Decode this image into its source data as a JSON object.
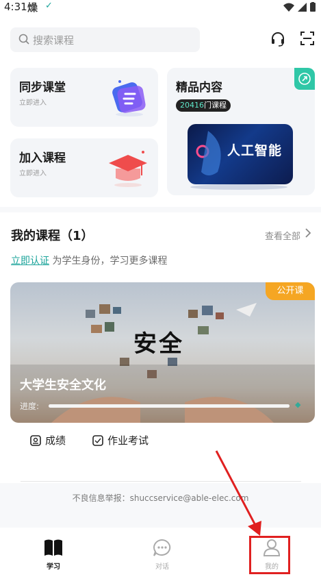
{
  "status": {
    "time": "4:31",
    "flame_icon": "flame-icon",
    "check_icon": "check-icon"
  },
  "search": {
    "placeholder": "搜索课程"
  },
  "cards": {
    "sync": {
      "title": "同步课堂",
      "sub": "立即进入"
    },
    "join": {
      "title": "加入课程",
      "sub": "立即进入"
    },
    "premium": {
      "title": "精品内容",
      "count": "20416",
      "count_suffix": "门课程",
      "banner_text": "人工智能"
    }
  },
  "my_courses": {
    "title": "我的课程（1）",
    "view_all": "查看全部",
    "verify_link": "立即认证",
    "verify_rest": "为学生身份，学习更多课程",
    "course": {
      "tag": "公开课",
      "cover_word": "安全",
      "name": "大学生安全文化",
      "progress_label": "进度:",
      "progress": 1.0
    },
    "tools": [
      {
        "label": "成绩",
        "icon": "grade-icon"
      },
      {
        "label": "作业考试",
        "icon": "exam-icon"
      }
    ]
  },
  "report": "不良信息举报：shuccservice@able-elec.com",
  "tabs": [
    {
      "label": "学习",
      "icon": "book-icon",
      "active": true
    },
    {
      "label": "对话",
      "icon": "chat-icon",
      "active": false
    },
    {
      "label": "我的",
      "icon": "user-icon",
      "active": false
    }
  ],
  "colors": {
    "accent": "#1aa39a",
    "tag_orange": "#f5a623",
    "highlight_red": "#e02020"
  }
}
